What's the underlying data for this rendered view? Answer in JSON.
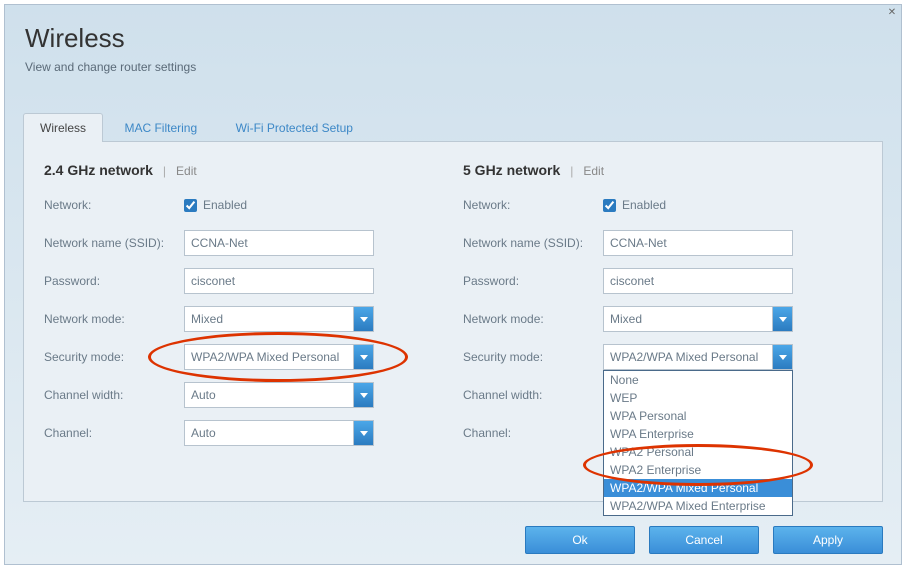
{
  "header": {
    "title": "Wireless",
    "subtitle": "View and change router settings"
  },
  "tabs": {
    "t0": "Wireless",
    "t1": "MAC Filtering",
    "t2": "Wi-Fi Protected Setup"
  },
  "edit": "Edit",
  "enabled": "Enabled",
  "labels": {
    "network": "Network:",
    "ssid": "Network name (SSID):",
    "password": "Password:",
    "mode": "Network mode:",
    "security": "Security mode:",
    "width": "Channel width:",
    "channel": "Channel:"
  },
  "band24": {
    "title": "2.4 GHz network",
    "ssid": "CCNA-Net",
    "password": "cisconet",
    "mode": "Mixed",
    "security": "WPA2/WPA Mixed Personal",
    "width": "Auto",
    "channel": "Auto"
  },
  "band5": {
    "title": "5 GHz network",
    "ssid": "CCNA-Net",
    "password": "cisconet",
    "mode": "Mixed",
    "security": "WPA2/WPA Mixed Personal"
  },
  "security_options": {
    "o0": "None",
    "o1": "WEP",
    "o2": "WPA Personal",
    "o3": "WPA Enterprise",
    "o4": "WPA2 Personal",
    "o5": "WPA2 Enterprise",
    "o6": "WPA2/WPA Mixed Personal",
    "o7": "WPA2/WPA Mixed Enterprise"
  },
  "buttons": {
    "ok": "Ok",
    "cancel": "Cancel",
    "apply": "Apply"
  }
}
